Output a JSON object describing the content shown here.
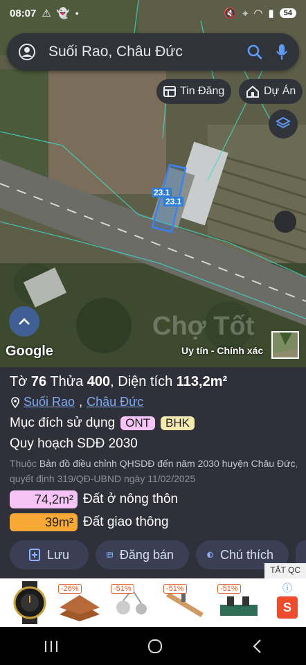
{
  "status_bar": {
    "time": "08:07",
    "battery": "54"
  },
  "search": {
    "text": "Suối Rao, Châu Đức"
  },
  "chips": {
    "listing": "Tin Đăng",
    "project": "Dự Án"
  },
  "map": {
    "parcel_labels": [
      "23.1",
      "23.1"
    ],
    "google": "Google",
    "credibility": "Uy tín - Chính xác",
    "watermark": "Chợ Tốt"
  },
  "parcel": {
    "sheet_label": "Tờ",
    "sheet_no": "76",
    "lot_label": "Thửa",
    "lot_no": "400",
    "area_label": "Diện tích",
    "area": "113,2m²",
    "ward": "Suối Rao",
    "comma": ",",
    "district": "Châu Đức",
    "purpose_label": "Mục đích sử dụng",
    "purpose_tags": [
      "ONT",
      "BHK"
    ],
    "plan_label": "Quy hoạch SDĐ 2030",
    "note_prefix": "Thuộc",
    "note_link": "Bản đồ điều chỉnh QHSDĐ đến năm 2030 huyện Châu Đức",
    "note_suffix": ", quyết định 319/QĐ-UBND ngày 11/02/2025",
    "areas": [
      {
        "value": "74,2m²",
        "label": "Đất ở nông thôn",
        "color": "#f5c3f5"
      },
      {
        "value": "39m²",
        "label": "Đất giao thông",
        "color": "#f7a835"
      }
    ]
  },
  "actions": {
    "save": "Lưu",
    "post": "Đăng bán",
    "legend": "Chú thích"
  },
  "ad": {
    "close": "TẮT QC",
    "discounts": [
      "-26%",
      "-51%",
      "-51%",
      "-51%"
    ],
    "brand": "S"
  }
}
